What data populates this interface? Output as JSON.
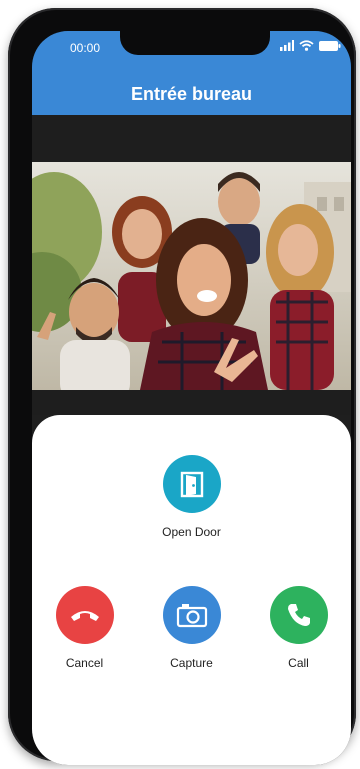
{
  "status_bar": {
    "time": "00:00"
  },
  "header": {
    "title": "Entrée bureau"
  },
  "actions": {
    "open_door": {
      "label": "Open Door",
      "color": "#1aa6c7"
    },
    "cancel": {
      "label": "Cancel",
      "color": "#e84343"
    },
    "capture": {
      "label": "Capture",
      "color": "#3a88d6"
    },
    "call": {
      "label": "Call",
      "color": "#2db25e"
    }
  },
  "icons": {
    "open_door": "door-icon",
    "cancel": "hangup-icon",
    "capture": "camera-icon",
    "call": "phone-icon",
    "signal": "signal-icon",
    "wifi": "wifi-icon",
    "battery": "battery-icon"
  }
}
